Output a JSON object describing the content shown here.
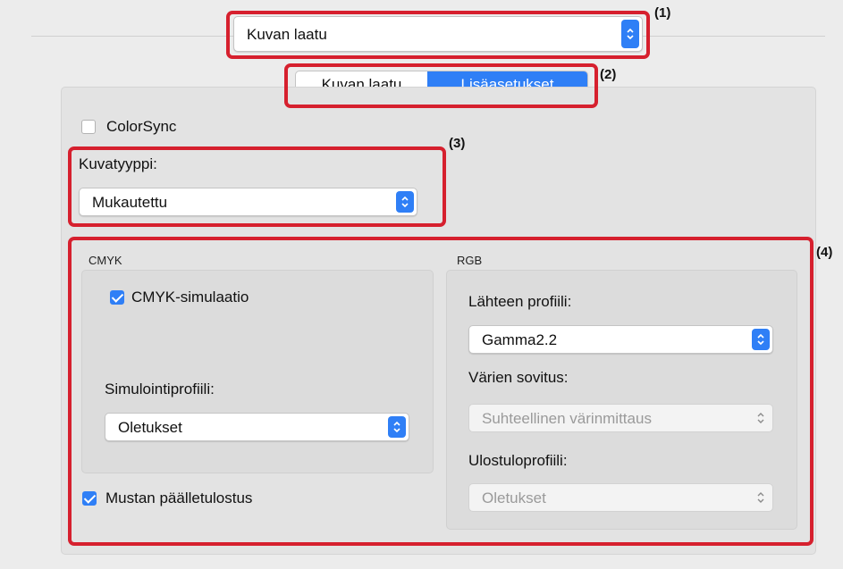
{
  "quality_popup": {
    "value": "Kuvan laatu"
  },
  "tabs": [
    {
      "label": "Kuvan laatu",
      "selected": false
    },
    {
      "label": "Lisäasetukset",
      "selected": true
    }
  ],
  "colorsync": {
    "label": "ColorSync",
    "checked": false
  },
  "image_type": {
    "label": "Kuvatyyppi:",
    "value": "Mukautettu"
  },
  "cmyk": {
    "title": "CMYK",
    "simulation_label": "CMYK-simulaatio",
    "simulation_checked": true,
    "profile_label": "Simulointiprofiili:",
    "profile_value": "Oletukset"
  },
  "black_overprint": {
    "label": "Mustan päälletulostus",
    "checked": true
  },
  "rgb": {
    "title": "RGB",
    "source_label": "Lähteen profiili:",
    "source_value": "Gamma2.2",
    "matching_label": "Värien sovitus:",
    "matching_value": "Suhteellinen värinmittaus",
    "output_label": "Ulostuloprofiili:",
    "output_value": "Oletukset"
  },
  "callouts": [
    "(1)",
    "(2)",
    "(3)",
    "(4)"
  ],
  "colors": {
    "accent": "#2f7ff6",
    "annotation": "#d6202e"
  }
}
